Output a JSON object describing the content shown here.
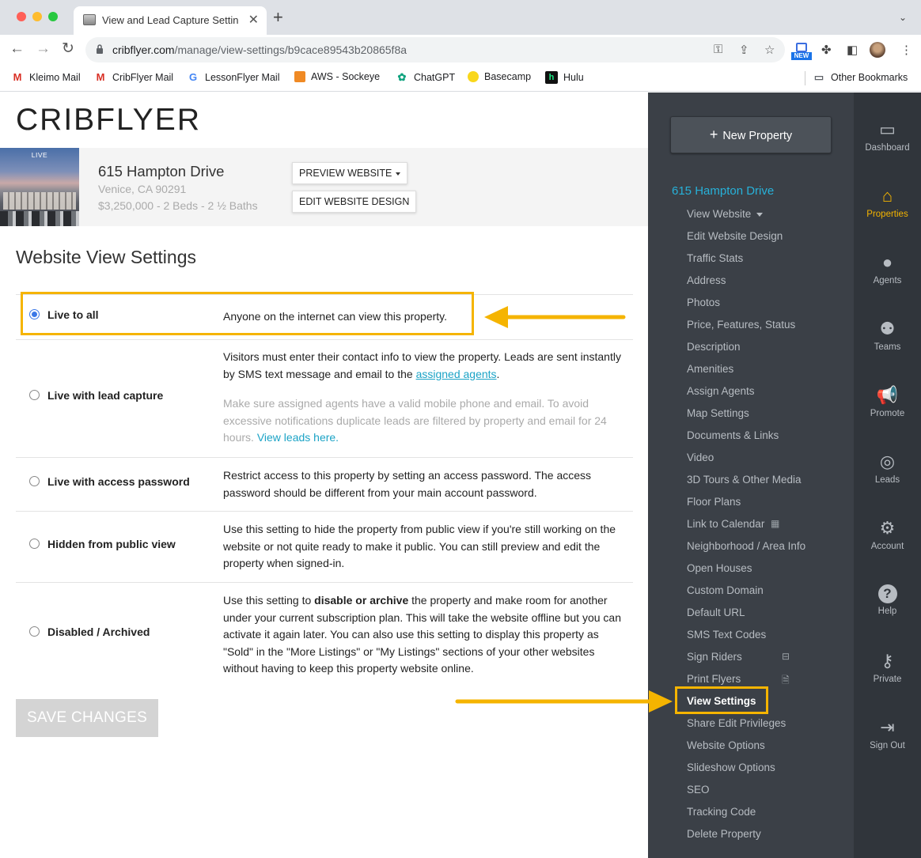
{
  "browser": {
    "tab_title": "View and Lead Capture Settings",
    "url_host": "cribflyer.com",
    "url_path": "/manage/view-settings/b9cace89543b20865f8a",
    "new_badge": "NEW",
    "bookmarks": [
      {
        "label": "Kleimo Mail",
        "icon": "gmail-icon"
      },
      {
        "label": "CribFlyer Mail",
        "icon": "gmail-icon"
      },
      {
        "label": "LessonFlyer Mail",
        "icon": "google-icon"
      },
      {
        "label": "AWS - Sockeye",
        "icon": "aws-icon"
      },
      {
        "label": "ChatGPT",
        "icon": "chatgpt-icon"
      },
      {
        "label": "Basecamp",
        "icon": "basecamp-icon"
      },
      {
        "label": "Hulu",
        "icon": "hulu-icon"
      }
    ],
    "other_bookmarks": "Other Bookmarks"
  },
  "app": {
    "logo": "CRIBFLYER"
  },
  "property": {
    "live_tag": "LIVE",
    "name": "615 Hampton Drive",
    "city": "Venice, CA 90291",
    "price_line": "$3,250,000 - 2 Beds - 2 ½ Baths",
    "preview_btn": "PREVIEW WEBSITE",
    "edit_btn": "EDIT WEBSITE DESIGN"
  },
  "settings": {
    "title": "Website View Settings",
    "selected": "live_all",
    "options": [
      {
        "label": "Live to all",
        "desc": "Anyone on the internet can view this property."
      },
      {
        "label": "Live with lead capture",
        "desc_before": "Visitors must enter their contact info to view the property. Leads are sent instantly by SMS text message and email to the ",
        "desc_link": "assigned agents",
        "desc_after": ".",
        "note": "Make sure assigned agents have a valid mobile phone and email. To avoid excessive notifications duplicate leads are filtered by property and email for 24 hours. ",
        "note_link": "View leads here."
      },
      {
        "label": "Live with access password",
        "desc": "Restrict access to this property by setting an access password. The access password should be different from your main account password."
      },
      {
        "label": "Hidden from public view",
        "desc": "Use this setting to hide the property from public view if you're still working on the website or not quite ready to make it public. You can still preview and edit the property when signed-in."
      },
      {
        "label": "Disabled / Archived",
        "desc_before": "Use this setting to ",
        "desc_bold": "disable or archive",
        "desc_after": " the property and make room for another under your current subscription plan. This will take the website offline but you can activate it again later. You can also use this setting to display this property as \"Sold\" in the \"More Listings\" or \"My Listings\" sections of your other websites without having to keep this property website online."
      }
    ],
    "save_btn": "SAVE CHANGES"
  },
  "sidebar": {
    "new_property": "New Property",
    "property_name": "615 Hampton Drive",
    "items": [
      "View Website",
      "Edit Website Design",
      "Traffic Stats",
      "Address",
      "Photos",
      "Price, Features, Status",
      "Description",
      "Amenities",
      "Assign Agents",
      "Map Settings",
      "Documents & Links",
      "Video",
      "3D Tours & Other Media",
      "Floor Plans",
      "Link to Calendar",
      "Neighborhood / Area Info",
      "Open Houses",
      "Custom Domain",
      "Default URL",
      "SMS Text Codes",
      "Sign Riders",
      "Print Flyers",
      "View Settings",
      "Share Edit Privileges",
      "Website Options",
      "Slideshow Options",
      "SEO",
      "Tracking Code",
      "Delete Property"
    ],
    "active_item": "View Settings"
  },
  "iconbar": [
    {
      "label": "Dashboard",
      "icon": "dashboard-icon"
    },
    {
      "label": "Properties",
      "icon": "home-icon"
    },
    {
      "label": "Agents",
      "icon": "user-icon"
    },
    {
      "label": "Teams",
      "icon": "team-icon"
    },
    {
      "label": "Promote",
      "icon": "megaphone-icon"
    },
    {
      "label": "Leads",
      "icon": "target-icon"
    },
    {
      "label": "Account",
      "icon": "gear-icon"
    },
    {
      "label": "Help",
      "icon": "help-icon"
    },
    {
      "label": "Private",
      "icon": "key-icon"
    },
    {
      "label": "Sign Out",
      "icon": "sign-out-icon"
    }
  ],
  "colors": {
    "accent": "#27b1d9",
    "sidebar_bg": "#3b4047",
    "iconbar_bg": "#30353b",
    "active_icon": "#f4b400",
    "annotation": "#f5b400"
  }
}
